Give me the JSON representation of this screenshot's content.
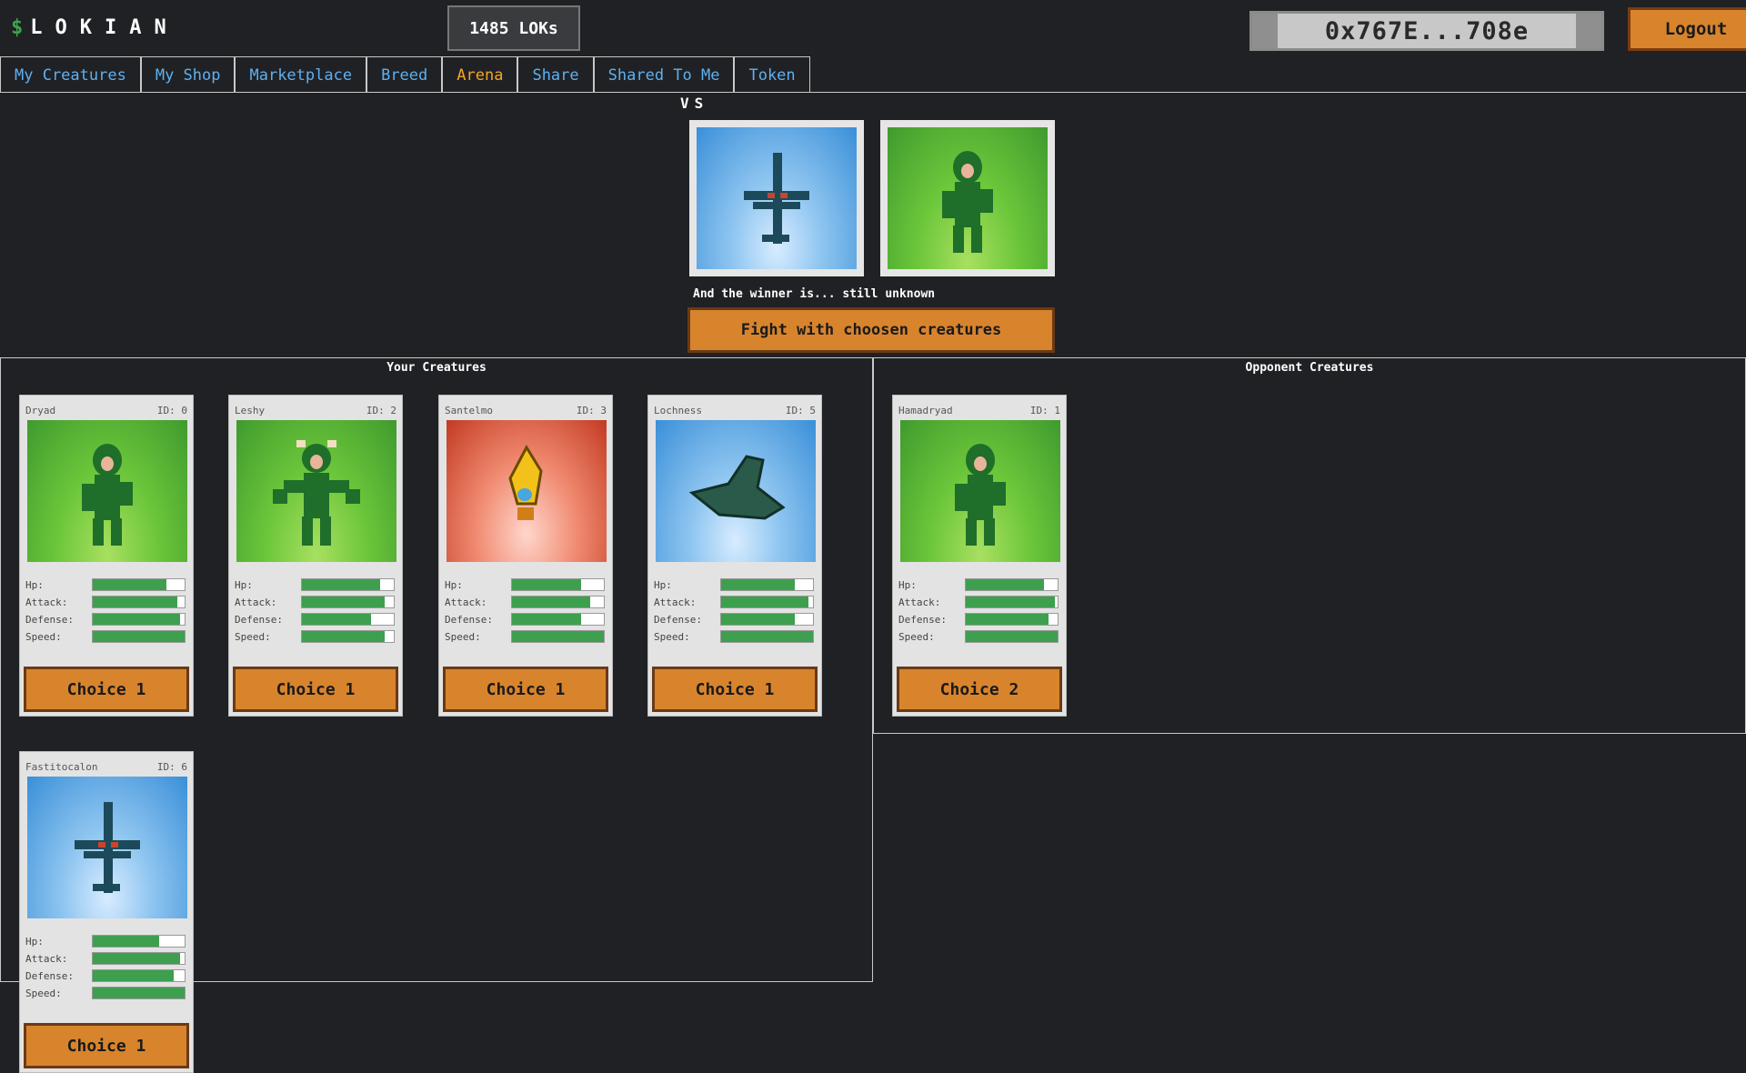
{
  "brand": {
    "dollar": "$",
    "name": "LOKIAN"
  },
  "balance": "1485 LOKs",
  "wallet": "0x767E...708e",
  "logout": "Logout",
  "tabs": [
    "My Creatures",
    "My Shop",
    "Marketplace",
    "Breed",
    "Arena",
    "Share",
    "Shared To Me",
    "Token"
  ],
  "active_tab": "Arena",
  "arena": {
    "vs": "VS",
    "winner_text": "And the winner is... still unknown",
    "fight_button": "Fight with choosen creatures"
  },
  "your_panel": {
    "title": "Your Creatures",
    "cards": [
      {
        "name": "Dryad",
        "id": "ID: 0",
        "stats": {
          "hp": 0.8,
          "attack": 0.92,
          "defense": 0.95,
          "speed": 1.0
        },
        "choice": "Choice 1",
        "env": "forest"
      },
      {
        "name": "Leshy",
        "id": "ID: 2",
        "stats": {
          "hp": 0.85,
          "attack": 0.9,
          "defense": 0.75,
          "speed": 0.9
        },
        "choice": "Choice 1",
        "env": "forest"
      },
      {
        "name": "Santelmo",
        "id": "ID: 3",
        "stats": {
          "hp": 0.75,
          "attack": 0.85,
          "defense": 0.75,
          "speed": 1.0
        },
        "choice": "Choice 1",
        "env": "fire"
      },
      {
        "name": "Lochness",
        "id": "ID: 5",
        "stats": {
          "hp": 0.8,
          "attack": 0.95,
          "defense": 0.8,
          "speed": 1.0
        },
        "choice": "Choice 1",
        "env": "water"
      },
      {
        "name": "Fastitocalon",
        "id": "ID: 6",
        "stats": {
          "hp": 0.72,
          "attack": 0.95,
          "defense": 0.88,
          "speed": 1.0
        },
        "choice": "Choice 1",
        "env": "water"
      }
    ]
  },
  "opponent_panel": {
    "title": "Opponent Creatures",
    "cards": [
      {
        "name": "Hamadryad",
        "id": "ID: 1",
        "stats": {
          "hp": 0.85,
          "attack": 0.97,
          "defense": 0.9,
          "speed": 1.0
        },
        "choice": "Choice 2",
        "env": "forest"
      }
    ]
  },
  "stat_labels": {
    "hp": "Hp:",
    "attack": "Attack:",
    "defense": "Defense:",
    "speed": "Speed:"
  },
  "colors": {
    "accent_tab": "#f5a623",
    "tab_text": "#5fb0f0",
    "button": "#d8842d",
    "stat_fill": "#3e9f4f"
  }
}
